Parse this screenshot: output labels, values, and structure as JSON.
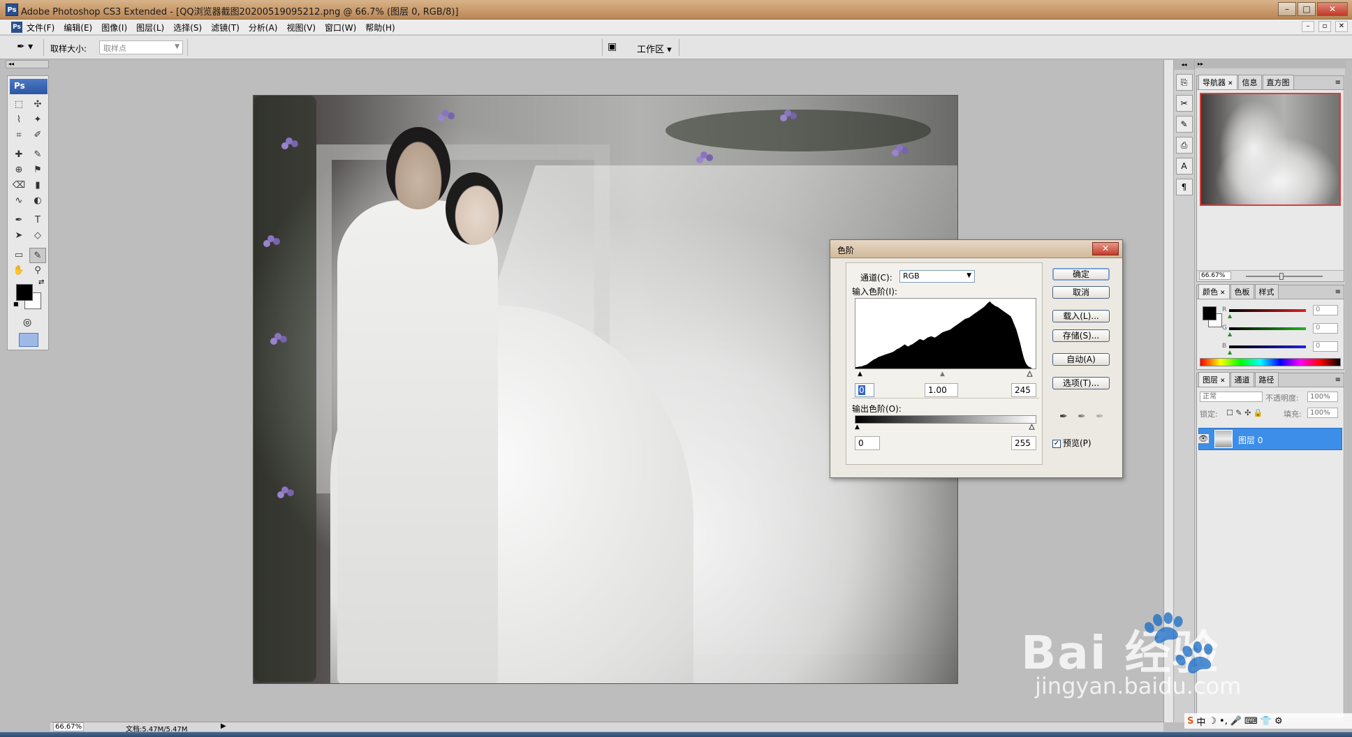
{
  "window": {
    "app_icon": "Ps",
    "title": "Adobe Photoshop CS3 Extended - [QQ浏览器截图20200519095212.png @ 66.7% (图层 0, RGB/8)]",
    "buttons": {
      "minimize": "–",
      "maximize": "□",
      "close": "✕"
    }
  },
  "menu": {
    "items": [
      "文件(F)",
      "编辑(E)",
      "图像(I)",
      "图层(L)",
      "选择(S)",
      "滤镜(T)",
      "分析(A)",
      "视图(V)",
      "窗口(W)",
      "帮助(H)"
    ],
    "doc_buttons": [
      "–",
      "▫",
      "✕"
    ]
  },
  "options": {
    "tool_icon": "eyedropper-icon",
    "sample_size_label": "取样大小:",
    "sample_size_value": "取样点",
    "workspace_label": "工作区 ▾"
  },
  "toolbox": {
    "badge": "Ps",
    "tools": [
      "⬚",
      "✣",
      "⌇",
      "✦",
      "⌗",
      "✐",
      "✚",
      "✎",
      "⊕",
      "⚑",
      "⌫",
      "▮",
      "∿",
      "◐",
      "✒",
      "T",
      "➤",
      "◇",
      "▭",
      "✎",
      "✋",
      "⚲"
    ]
  },
  "status": {
    "zoom": "66.67%",
    "doc_info": "文档:5.47M/5.47M"
  },
  "panels": {
    "navigator": {
      "tabs": [
        "导航器",
        "信息",
        "直方图"
      ],
      "zoom": "66.67%"
    },
    "color": {
      "tabs": [
        "颜色",
        "色板",
        "样式"
      ],
      "channels": [
        {
          "label": "R",
          "value": "0",
          "color": "#d31f1f"
        },
        {
          "label": "G",
          "value": "0",
          "color": "#21b421"
        },
        {
          "label": "B",
          "value": "0",
          "color": "#1f2ad3"
        }
      ]
    },
    "layers": {
      "tabs": [
        "图层",
        "通道",
        "路径"
      ],
      "blend_mode": "正常",
      "opacity_label": "不透明度:",
      "opacity_value": "100%",
      "lock_label": "锁定:",
      "fill_label": "填充:",
      "fill_value": "100%",
      "layer_name": "图层 0"
    }
  },
  "levels_dialog": {
    "title": "色阶",
    "channel_label": "通道(C):",
    "channel_value": "RGB",
    "input_label": "输入色阶(I):",
    "input_black": "0",
    "input_gamma": "1.00",
    "input_white": "245",
    "output_label": "输出色阶(O):",
    "output_black": "0",
    "output_white": "255",
    "buttons": {
      "ok": "确定",
      "cancel": "取消",
      "load": "载入(L)...",
      "save": "存储(S)...",
      "auto": "自动(A)",
      "options": "选项(T)..."
    },
    "preview_label": "预览(P)",
    "preview_checked": true,
    "histogram": [
      2,
      2,
      3,
      3,
      4,
      5,
      6,
      8,
      10,
      12,
      14,
      15,
      17,
      18,
      19,
      20,
      21,
      22,
      23,
      24,
      25,
      27,
      29,
      30,
      32,
      34,
      36,
      34,
      33,
      35,
      36,
      38,
      40,
      42,
      44,
      43,
      42,
      44,
      46,
      47,
      48,
      47,
      46,
      48,
      50,
      52,
      54,
      55,
      56,
      57,
      58,
      60,
      62,
      64,
      66,
      68,
      70,
      72,
      74,
      75,
      76,
      78,
      80,
      82,
      84,
      86,
      88,
      90,
      92,
      95,
      98,
      100,
      97,
      95,
      93,
      92,
      90,
      88,
      86,
      84,
      82,
      80,
      78,
      72,
      65,
      58,
      48,
      38,
      26,
      15,
      8,
      4,
      2,
      1
    ]
  },
  "watermark": {
    "brand": "Bai  经验",
    "url": "jingyan.baidu.com"
  },
  "ime": [
    "S",
    "中",
    "☽",
    "•,",
    "🎤",
    "⌨",
    "👕",
    "⚙"
  ]
}
